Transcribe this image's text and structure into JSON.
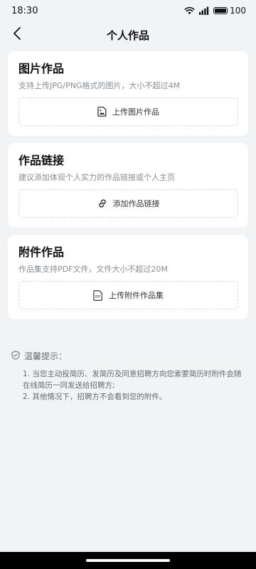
{
  "status_bar": {
    "time": "18:30",
    "battery": "100",
    "battery_level": 1.0
  },
  "header": {
    "title": "个人作品"
  },
  "sections": [
    {
      "title": "图片作品",
      "description": "支持上传JPG/PNG格式的图片，大小不超过4M",
      "button_label": "上传图片作品",
      "icon": "image-icon"
    },
    {
      "title": "作品链接",
      "description": "建议添加体现个人实力的作品链接或个人主页",
      "button_label": "添加作品链接",
      "icon": "link-icon"
    },
    {
      "title": "附件作品",
      "description": "作品集支持PDF文件，文件大小不超过20M",
      "button_label": "上传附件作品集",
      "icon": "pdf-file-icon",
      "icon_text": "PDF"
    }
  ],
  "tips": {
    "title": "温馨提示：",
    "items": [
      "1. 当您主动投简历、发简历及同意招聘方向您索要简历时附件会随在线简历一同发送给招聘方;",
      "2. 其他情况下，招聘方不会看到您的附件。"
    ]
  }
}
